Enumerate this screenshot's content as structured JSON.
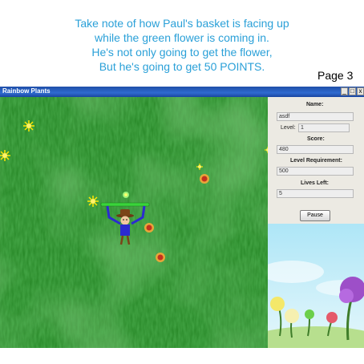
{
  "caption": {
    "line1": "Take note of how Paul's basket is facing up",
    "line2": "while the green flower is coming in.",
    "line3": "He's not only going to get the flower,",
    "line4": "But he's going to get 50 POINTS."
  },
  "page_label": "Page 3",
  "window": {
    "title": "Rainbow Plants",
    "buttons": {
      "minimize": "_",
      "maximize": "□",
      "close": "x"
    }
  },
  "panel": {
    "name_label": "Name:",
    "name_value": "asdf",
    "level_label": "Level:",
    "level_value": "1",
    "score_label": "Score:",
    "score_value": "480",
    "requirement_label": "Level Requirement:",
    "requirement_value": "500",
    "lives_label": "Lives Left:",
    "lives_value": "5",
    "pause_label": "Pause"
  },
  "colors": {
    "caption": "#2aa0d8",
    "grass": "#2e8a2c",
    "basket": "#39d43a",
    "player_shirt": "#2b2bd0",
    "title_bar": "#2f6bd0"
  }
}
